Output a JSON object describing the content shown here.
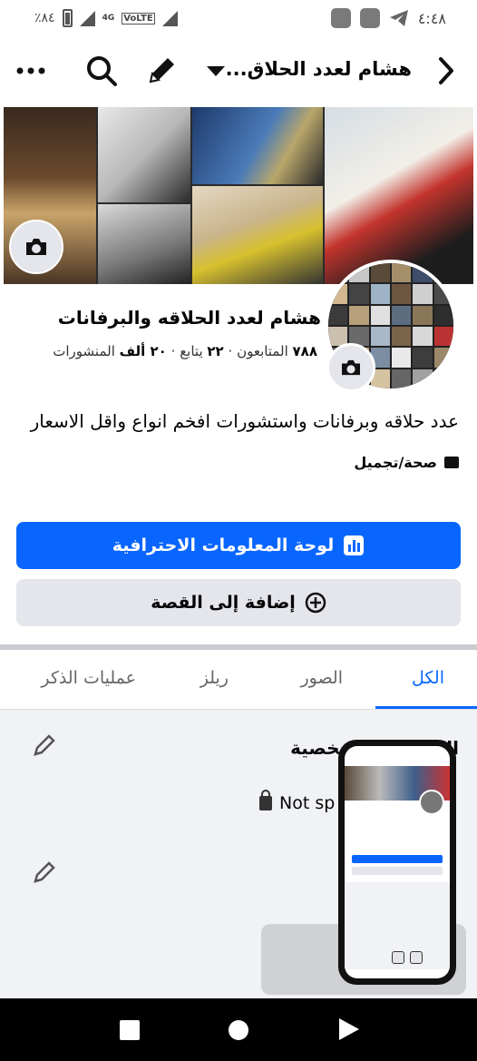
{
  "status_bar": {
    "time": "٤:٤٨",
    "battery": "٪٨٤",
    "network": "4G",
    "volte": "VoLTE"
  },
  "top_nav": {
    "title": "هشام لعدد الحلاق..."
  },
  "profile": {
    "name": "هشام لعدد الحلاقه والبرفانات",
    "followers_count": "٧٨٨",
    "followers_label": "المتابعون",
    "following_count": "٢٢",
    "following_label": "يتابع",
    "posts_count": "٢٠ ألف",
    "posts_label": "المنشورات",
    "separator": "·",
    "bio": "عدد حلاقه وبرفانات واستشورات افخم انواع واقل الاسعار",
    "category": "صحة/تجميل"
  },
  "buttons": {
    "professional_dashboard": "لوحة المعلومات الاحترافية",
    "add_to_story": "إضافة إلى القصة"
  },
  "tabs": [
    {
      "label": "الكل"
    },
    {
      "label": "الصور"
    },
    {
      "label": "ريلز"
    },
    {
      "label": "عمليات الذكر"
    }
  ],
  "details": {
    "title": "التفاصيل الشخصية",
    "not_specified": "Not sp"
  },
  "colors": {
    "accent": "#0866ff",
    "background_secondary": "#e4e6eb"
  },
  "icons": {
    "back": "chevron-right-icon",
    "more": "more-icon",
    "search": "search-icon",
    "edit": "pencil-icon",
    "dropdown": "caret-down-icon",
    "camera": "camera-icon",
    "dashboard": "chart-icon",
    "add": "plus-circle-icon",
    "lock": "lock-icon"
  }
}
